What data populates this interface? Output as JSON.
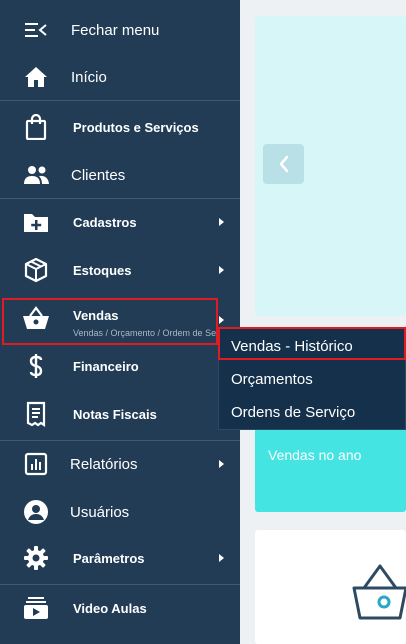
{
  "sidebar": {
    "items": [
      {
        "label": "Fechar menu",
        "icon": "menu-close-icon"
      },
      {
        "label": "Início",
        "icon": "home-icon"
      },
      {
        "label": "Produtos e Serviços",
        "icon": "shopping-bag-icon"
      },
      {
        "label": "Clientes",
        "icon": "users-icon"
      },
      {
        "label": "Cadastros",
        "icon": "folder-plus-icon"
      },
      {
        "label": "Estoques",
        "icon": "box-icon"
      },
      {
        "label": "Vendas",
        "icon": "basket-icon",
        "sublabel": "Vendas / Orçamento / Ordem de Serviço"
      },
      {
        "label": "Financeiro",
        "icon": "dollar-icon"
      },
      {
        "label": "Notas Fiscais",
        "icon": "receipt-icon"
      },
      {
        "label": "Relatórios",
        "icon": "chart-icon"
      },
      {
        "label": "Usuários",
        "icon": "user-circle-icon"
      },
      {
        "label": "Parâmetros",
        "icon": "gear-icon"
      },
      {
        "label": "Video Aulas",
        "icon": "video-icon"
      }
    ]
  },
  "dropdown": {
    "items": [
      "Vendas - Histórico",
      "Orçamentos",
      "Ordens de Serviço"
    ]
  },
  "main": {
    "card2_title": "Vendas no ano"
  },
  "colors": {
    "sidebar_bg": "#213c54",
    "highlight": "#e11b22",
    "accent_cyan": "#43e4e2"
  }
}
